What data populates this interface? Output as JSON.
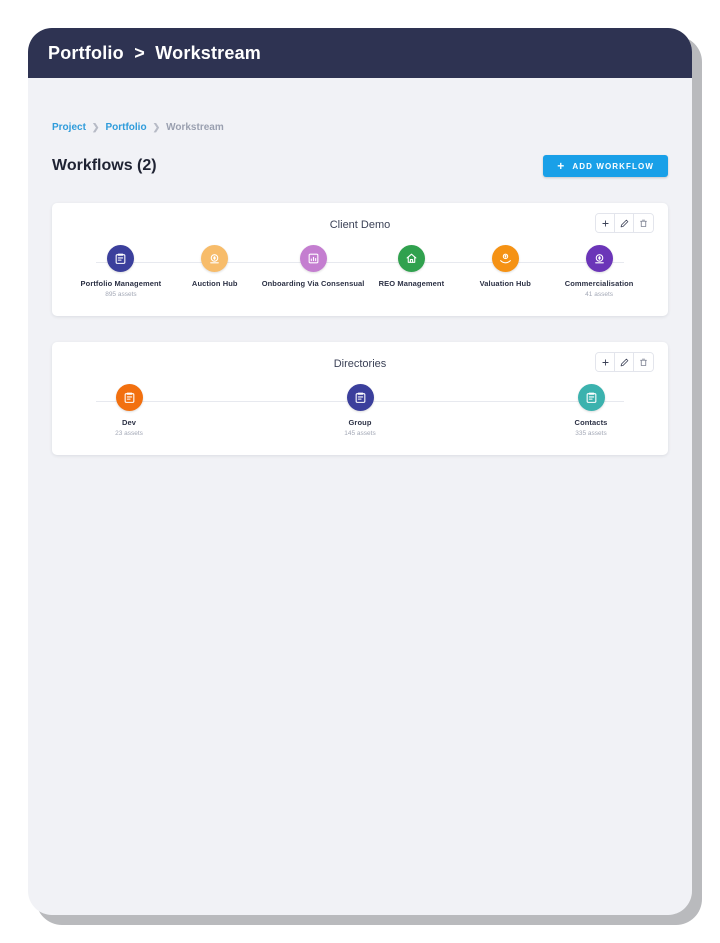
{
  "window": {
    "header_title": "Portfolio  >  Workstream"
  },
  "breadcrumb": {
    "items": [
      {
        "label": "Project",
        "type": "link"
      },
      {
        "label": "Portfolio",
        "type": "link"
      },
      {
        "label": "Workstream",
        "type": "current"
      }
    ],
    "separator": "❯"
  },
  "page": {
    "title": "Workflows (2)",
    "add_button": {
      "label": "ADD WORKFLOW",
      "icon": "plus-icon",
      "plus": "+"
    }
  },
  "card_actions": {
    "add": {
      "name": "add-node-button",
      "icon": "plus-icon"
    },
    "edit": {
      "name": "edit-workflow-button",
      "icon": "pencil-icon"
    },
    "delete": {
      "name": "delete-workflow-button",
      "icon": "trash-icon"
    }
  },
  "colors": {
    "header_bg": "#2e3352",
    "accent_blue": "#19a0e8",
    "page_bg": "#f1f2f6",
    "link": "#2f9cdb",
    "muted": "#9aa0b0"
  },
  "workflows": [
    {
      "title": "Client Demo",
      "nodes": [
        {
          "label": "Portfolio Management",
          "assets": "895 assets",
          "color": "#3b3f9c",
          "icon": "clipboard-icon"
        },
        {
          "label": "Auction Hub",
          "assets": "",
          "color": "#f7bc6a",
          "icon": "coin-icon"
        },
        {
          "label": "Onboarding Via Consensual",
          "assets": "",
          "color": "#c47ed0",
          "icon": "bar-chart-icon"
        },
        {
          "label": "REO Management",
          "assets": "",
          "color": "#30a14e",
          "icon": "home-icon"
        },
        {
          "label": "Valuation Hub",
          "assets": "",
          "color": "#f59214",
          "icon": "hand-coin-icon"
        },
        {
          "label": "Commercialisation",
          "assets": "41 assets",
          "color": "#6b35b8",
          "icon": "coin-icon"
        }
      ]
    },
    {
      "title": "Directories",
      "nodes": [
        {
          "label": "Dev",
          "assets": "23 assets",
          "color": "#f2700f",
          "icon": "clipboard-icon"
        },
        {
          "label": "Group",
          "assets": "145 assets",
          "color": "#3b3f9c",
          "icon": "clipboard-icon"
        },
        {
          "label": "Contacts",
          "assets": "335 assets",
          "color": "#3bb2ae",
          "icon": "clipboard-icon"
        }
      ]
    }
  ]
}
